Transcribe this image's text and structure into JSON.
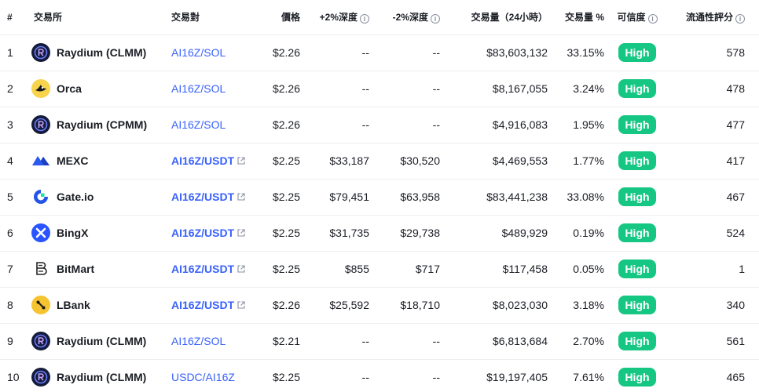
{
  "headers": {
    "rank": "#",
    "exchange": "交易所",
    "pair": "交易對",
    "price": "價格",
    "depth_plus": "+2%深度",
    "depth_minus": "-2%深度",
    "volume": "交易量（24小時）",
    "volume_pct": "交易量 %",
    "confidence": "可信度",
    "liquidity": "流通性評分"
  },
  "info_glyph": "i",
  "rows": [
    {
      "rank": "1",
      "exchange": "Raydium (CLMM)",
      "logo": "raydium-logo",
      "pair": "AI16Z/SOL",
      "external": false,
      "price": "$2.26",
      "depth_plus": "--",
      "depth_minus": "--",
      "volume": "$83,603,132",
      "volume_pct": "33.15%",
      "confidence": "High",
      "liquidity": "578"
    },
    {
      "rank": "2",
      "exchange": "Orca",
      "logo": "orca-logo",
      "pair": "AI16Z/SOL",
      "external": false,
      "price": "$2.26",
      "depth_plus": "--",
      "depth_minus": "--",
      "volume": "$8,167,055",
      "volume_pct": "3.24%",
      "confidence": "High",
      "liquidity": "478"
    },
    {
      "rank": "3",
      "exchange": "Raydium (CPMM)",
      "logo": "raydium-logo",
      "pair": "AI16Z/SOL",
      "external": false,
      "price": "$2.26",
      "depth_plus": "--",
      "depth_minus": "--",
      "volume": "$4,916,083",
      "volume_pct": "1.95%",
      "confidence": "High",
      "liquidity": "477"
    },
    {
      "rank": "4",
      "exchange": "MEXC",
      "logo": "mexc-logo",
      "pair": "AI16Z/USDT",
      "external": true,
      "price": "$2.25",
      "depth_plus": "$33,187",
      "depth_minus": "$30,520",
      "volume": "$4,469,553",
      "volume_pct": "1.77%",
      "confidence": "High",
      "liquidity": "417"
    },
    {
      "rank": "5",
      "exchange": "Gate.io",
      "logo": "gateio-logo",
      "pair": "AI16Z/USDT",
      "external": true,
      "price": "$2.25",
      "depth_plus": "$79,451",
      "depth_minus": "$63,958",
      "volume": "$83,441,238",
      "volume_pct": "33.08%",
      "confidence": "High",
      "liquidity": "467"
    },
    {
      "rank": "6",
      "exchange": "BingX",
      "logo": "bingx-logo",
      "pair": "AI16Z/USDT",
      "external": true,
      "price": "$2.25",
      "depth_plus": "$31,735",
      "depth_minus": "$29,738",
      "volume": "$489,929",
      "volume_pct": "0.19%",
      "confidence": "High",
      "liquidity": "524"
    },
    {
      "rank": "7",
      "exchange": "BitMart",
      "logo": "bitmart-logo",
      "pair": "AI16Z/USDT",
      "external": true,
      "price": "$2.25",
      "depth_plus": "$855",
      "depth_minus": "$717",
      "volume": "$117,458",
      "volume_pct": "0.05%",
      "confidence": "High",
      "liquidity": "1"
    },
    {
      "rank": "8",
      "exchange": "LBank",
      "logo": "lbank-logo",
      "pair": "AI16Z/USDT",
      "external": true,
      "price": "$2.26",
      "depth_plus": "$25,592",
      "depth_minus": "$18,710",
      "volume": "$8,023,030",
      "volume_pct": "3.18%",
      "confidence": "High",
      "liquidity": "340"
    },
    {
      "rank": "9",
      "exchange": "Raydium (CLMM)",
      "logo": "raydium-logo",
      "pair": "AI16Z/SOL",
      "external": false,
      "price": "$2.21",
      "depth_plus": "--",
      "depth_minus": "--",
      "volume": "$6,813,684",
      "volume_pct": "2.70%",
      "confidence": "High",
      "liquidity": "561"
    },
    {
      "rank": "10",
      "exchange": "Raydium (CLMM)",
      "logo": "raydium-logo",
      "pair": "USDC/AI16Z",
      "external": false,
      "price": "$2.25",
      "depth_plus": "--",
      "depth_minus": "--",
      "volume": "$19,197,405",
      "volume_pct": "7.61%",
      "confidence": "High",
      "liquidity": "465"
    }
  ],
  "colors": {
    "link": "#3861fb",
    "badge": "#16c784",
    "divider": "#eceef2"
  }
}
